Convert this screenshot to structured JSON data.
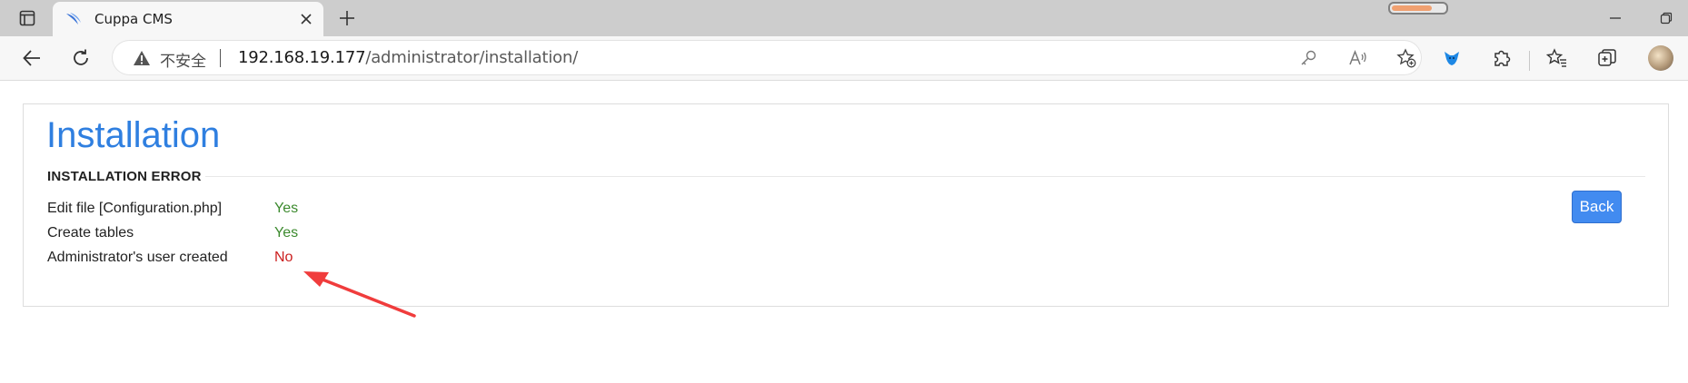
{
  "browser": {
    "tab": {
      "title": "Cuppa CMS"
    },
    "address_bar": {
      "security_label": "不安全",
      "url_host": "192.168.19.177",
      "url_path": "/administrator/installation/"
    },
    "profile_progress": 0.75
  },
  "page": {
    "title": "Installation",
    "section_heading": "INSTALLATION ERROR",
    "status_rows": [
      {
        "label": "Edit file [Configuration.php]",
        "value": "Yes",
        "color": "#3c8a2e"
      },
      {
        "label": "Create tables",
        "value": "Yes",
        "color": "#3c8a2e"
      },
      {
        "label": "Administrator's user created",
        "value": "No",
        "color": "#cc2020"
      }
    ],
    "back_button": "Back",
    "annotation_color": "#f03c3c"
  }
}
